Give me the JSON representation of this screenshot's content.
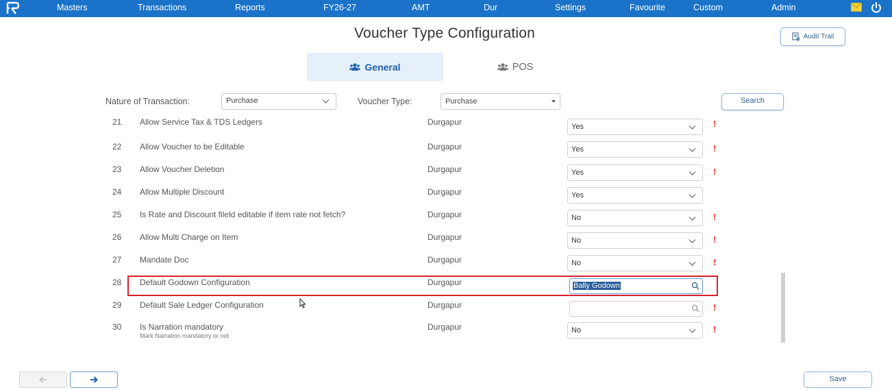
{
  "nav": {
    "items": [
      "Masters",
      "Transactions",
      "Reports",
      "FY26-27",
      "AMT",
      "Dur",
      "Settings",
      "Favourite",
      "Custom",
      "Admin"
    ]
  },
  "page": {
    "title": "Voucher Type Configuration",
    "audit_label": "Audit Trail"
  },
  "tabs": {
    "general": "General",
    "pos": "POS"
  },
  "filters": {
    "nature_label": "Nature of Transaction:",
    "nature_value": "Purchase",
    "voucher_label": "Voucher Type:",
    "voucher_value": "Purchase",
    "search_label": "Search"
  },
  "rows": [
    {
      "num": "21",
      "label": "Allow Service Tax & TDS Ledgers",
      "location": "Durgapur",
      "value": "Yes",
      "warning": "!"
    },
    {
      "num": "22",
      "label": "Allow Voucher to be Editable",
      "location": "Durgapur",
      "value": "Yes",
      "warning": "!"
    },
    {
      "num": "23",
      "label": "Allow Voucher Deletion",
      "location": "Durgapur",
      "value": "Yes",
      "warning": "!"
    },
    {
      "num": "24",
      "label": "Allow Multiple Discount",
      "location": "Durgapur",
      "value": "Yes",
      "warning": ""
    },
    {
      "num": "25",
      "label": "Is Rate and Discount fileld editable if item rate not fetch?",
      "location": "Durgapur",
      "value": "No",
      "warning": "!"
    },
    {
      "num": "26",
      "label": "Allow Multi Charge on Item",
      "location": "Durgapur",
      "value": "No",
      "warning": "!"
    },
    {
      "num": "27",
      "label": "Mandate Doc",
      "location": "Durgapur",
      "value": "No",
      "warning": "!"
    },
    {
      "num": "28",
      "label": "Default Godown Configuration",
      "location": "Durgapur",
      "value": "Bally Godown",
      "warning": ""
    },
    {
      "num": "29",
      "label": "Default Sale Ledger Configuration",
      "location": "Durgapur",
      "value": "",
      "warning": "!"
    },
    {
      "num": "30",
      "label": "Is Narration mandatory",
      "sublabel": "Mark Narration mandatory or not",
      "location": "Durgapur",
      "value": "No",
      "warning": "!"
    }
  ],
  "footer": {
    "save_label": "Save"
  },
  "colors": {
    "topbar": "#1a73c9",
    "accent": "#1b5fae",
    "highlight": "#d8202a",
    "warning": "#e33333"
  }
}
